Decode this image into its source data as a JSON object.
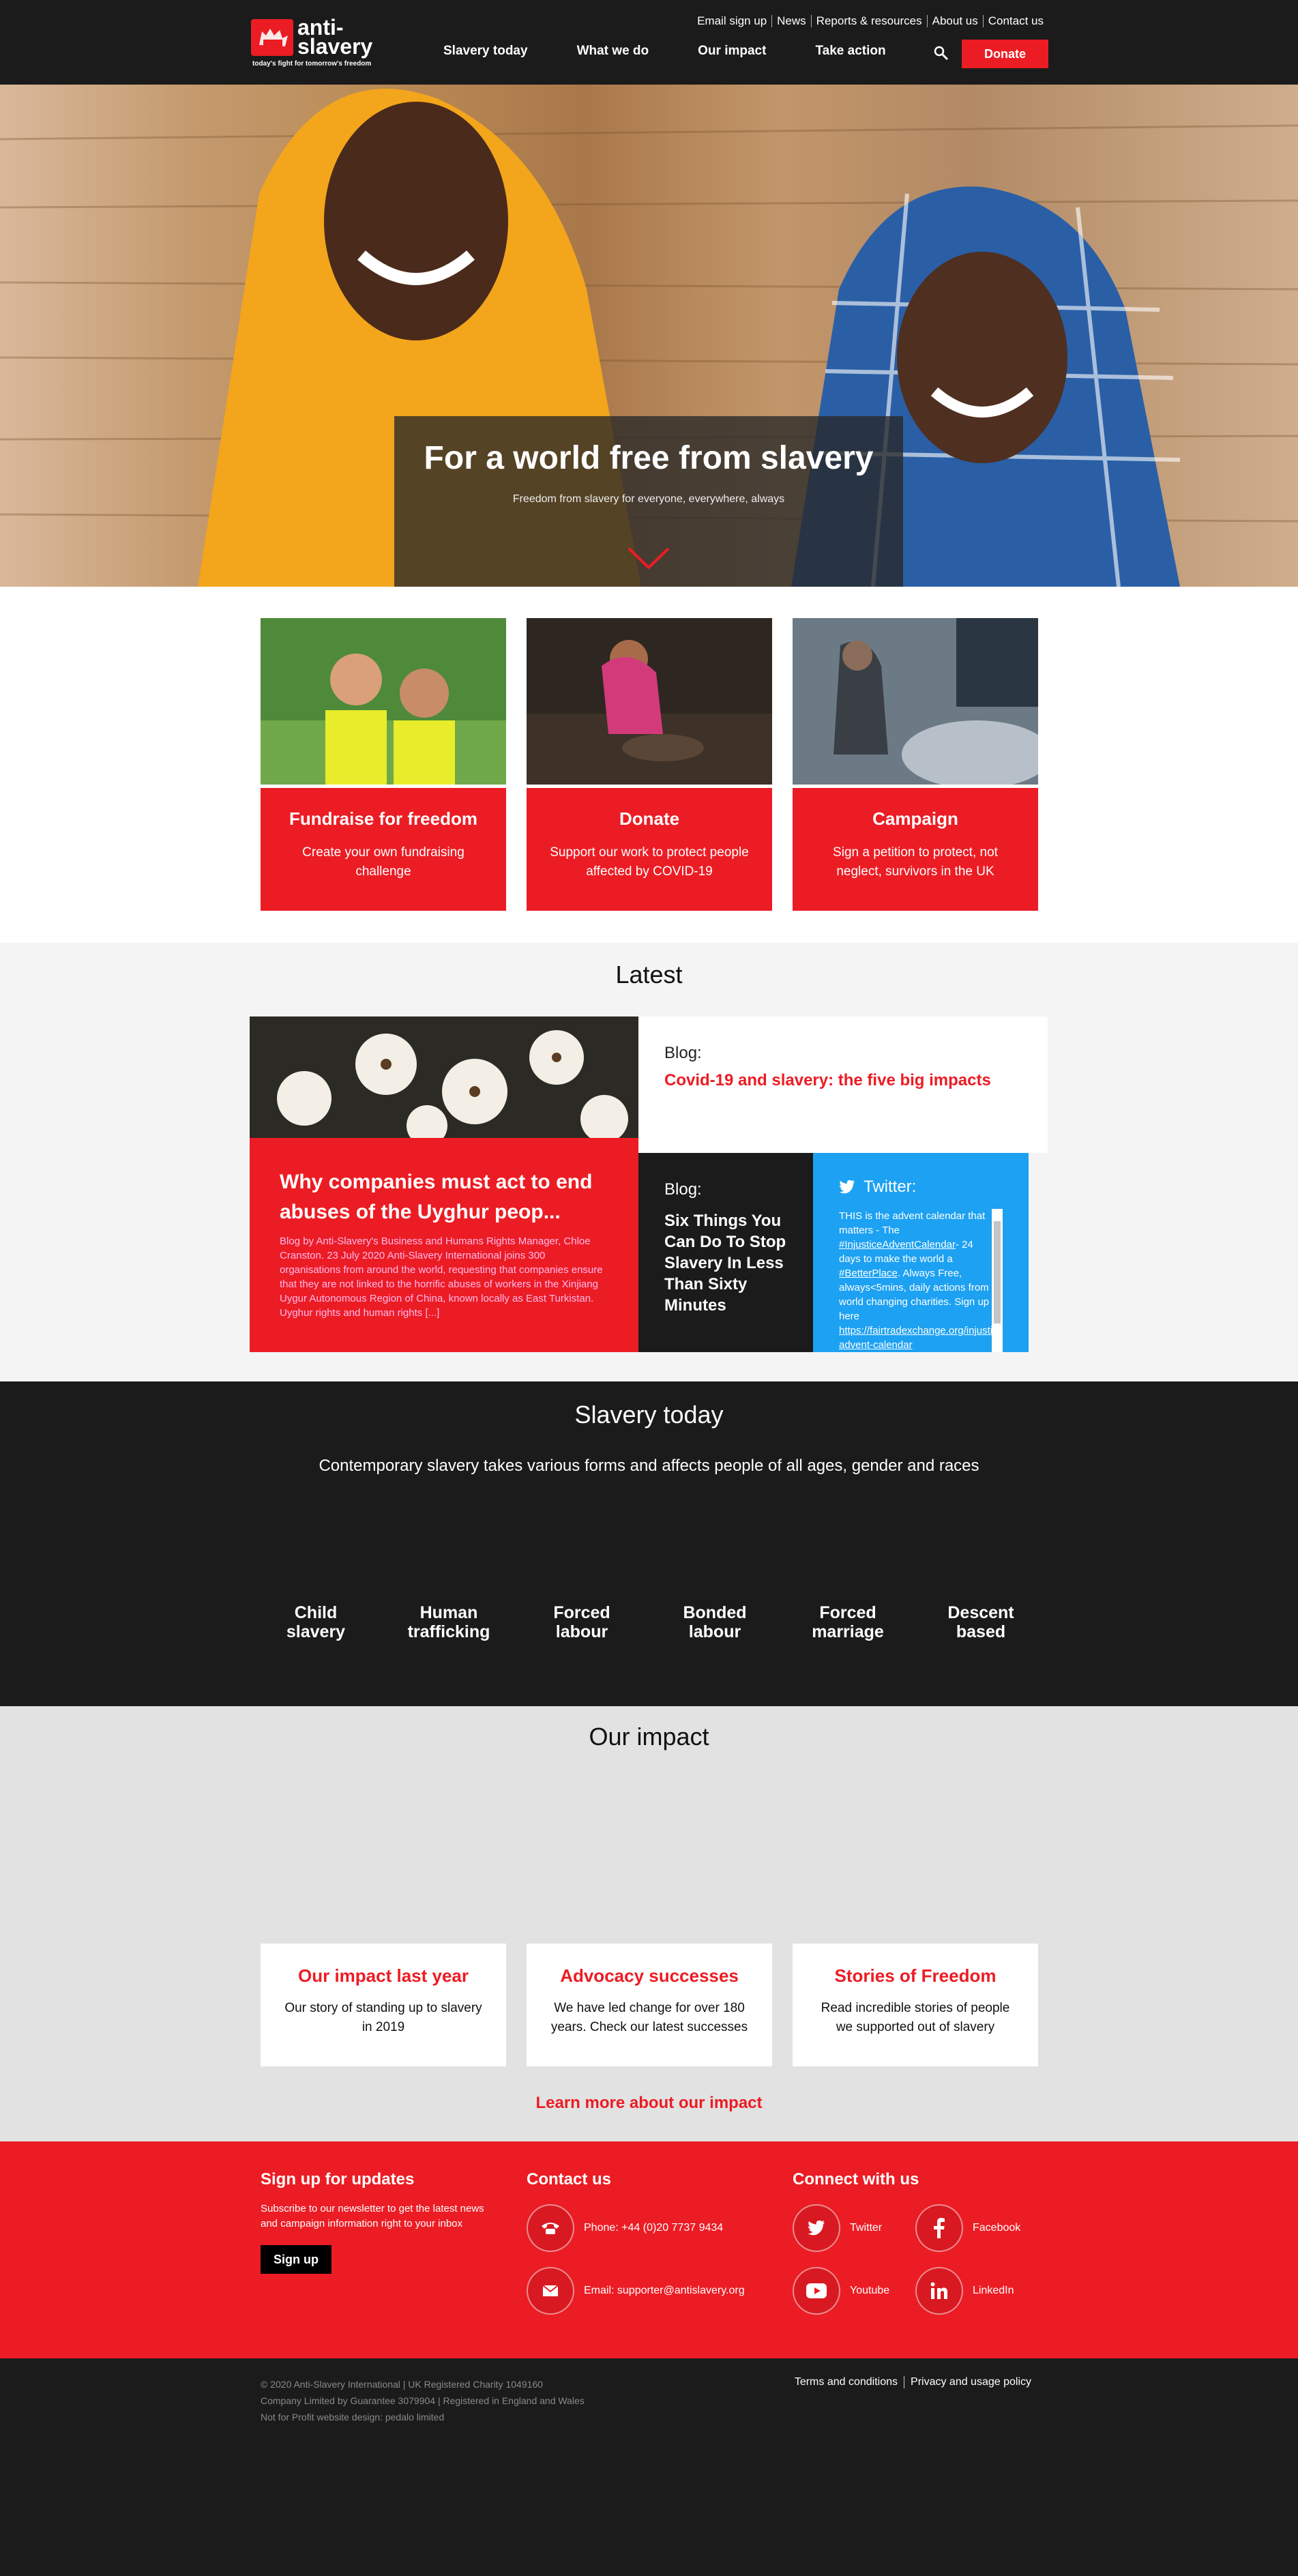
{
  "header": {
    "logo_line1": "anti-",
    "logo_line2": "slavery",
    "logo_tagline": "today's fight for tomorrow's freedom",
    "utility_nav": [
      "Email sign up",
      "News",
      "Reports & resources",
      "About us",
      "Contact us"
    ],
    "main_nav": [
      "Slavery today",
      "What we do",
      "Our impact",
      "Take action"
    ],
    "donate_label": "Donate"
  },
  "hero": {
    "title": "For a world free from slavery",
    "subtitle": "Freedom from slavery for everyone, everywhere, always"
  },
  "actions": [
    {
      "title": "Fundraise for freedom",
      "text": "Create your own fundraising challenge"
    },
    {
      "title": "Donate",
      "text": "Support our work to protect people affected by COVID-19"
    },
    {
      "title": "Campaign",
      "text": "Sign a petition to protect, not neglect, survivors in the UK"
    }
  ],
  "latest": {
    "heading": "Latest",
    "feature": {
      "title": "Why companies must act to end abuses of the Uyghur peop...",
      "text": "Blog by Anti-Slavery's Business and Humans Rights Manager, Chloe Cranston. 23 July 2020 Anti-Slavery International joins 300 organisations from around the world, requesting that companies ensure that they are not linked to the horrific abuses of workers in the Xinjiang Uygur Autonomous Region of China, known locally as East Turkistan. Uyghur rights and human rights [...]"
    },
    "blog1": {
      "label": "Blog:",
      "title": "Covid-19 and slavery: the five big impacts"
    },
    "blog2": {
      "label": "Blog:",
      "title": "Six Things You Can Do To Stop Slavery In Less Than Sixty Minutes"
    },
    "twitter": {
      "label": "Twitter:",
      "text_before": "THIS is the advent calendar that matters - The ",
      "hashtag1": "#InjusticeAdventCalendar",
      "text_mid": "- 24 days to make the world a ",
      "hashtag2": "#BetterPlace",
      "text_after": ". Always Free, always<5mins, daily actions from world changing charities. Sign up here ",
      "link": "https://fairtradexchange.org/injustice-advent-calendar"
    }
  },
  "slavery_today": {
    "heading": "Slavery today",
    "subtitle": "Contemporary slavery takes various forms and affects people of all ages, gender and races",
    "items": [
      {
        "line1": "Child",
        "line2": "slavery"
      },
      {
        "line1": "Human",
        "line2": "trafficking"
      },
      {
        "line1": "Forced",
        "line2": "labour"
      },
      {
        "line1": "Bonded",
        "line2": "labour"
      },
      {
        "line1": "Forced",
        "line2": "marriage"
      },
      {
        "line1": "Descent",
        "line2": "based"
      }
    ]
  },
  "impact": {
    "heading": "Our impact",
    "cards": [
      {
        "title": "Our impact last year",
        "text": "Our story of standing up to slavery in 2019"
      },
      {
        "title": "Advocacy successes",
        "text": "We have led change for over 180 years. Check our latest successes"
      },
      {
        "title": "Stories of Freedom",
        "text": "Read incredible stories of people we supported out of slavery"
      }
    ],
    "link": "Learn more about our impact"
  },
  "footer": {
    "signup_title": "Sign up for updates",
    "signup_text": "Subscribe to our newsletter to get the latest news and campaign information right to your inbox",
    "signup_button": "Sign up",
    "contact_title": "Contact us",
    "phone": "Phone: +44 (0)20 7737 9434",
    "email": "Email: supporter@antislavery.org",
    "connect_title": "Connect with us",
    "social": [
      "Twitter",
      "Facebook",
      "Youtube",
      "LinkedIn"
    ],
    "legal_1": "© 2020 Anti-Slavery International | UK Registered Charity 1049160",
    "legal_2": "Company Limited by Guarantee 3079904 | Registered in England and Wales",
    "legal_3": "Not for Profit website design: pedalo limited",
    "links": [
      "Terms and conditions",
      "Privacy and usage policy"
    ]
  },
  "colors": {
    "brand_red": "#ec1c24",
    "dark": "#1b1b1b",
    "twitter_blue": "#1da1f2"
  }
}
